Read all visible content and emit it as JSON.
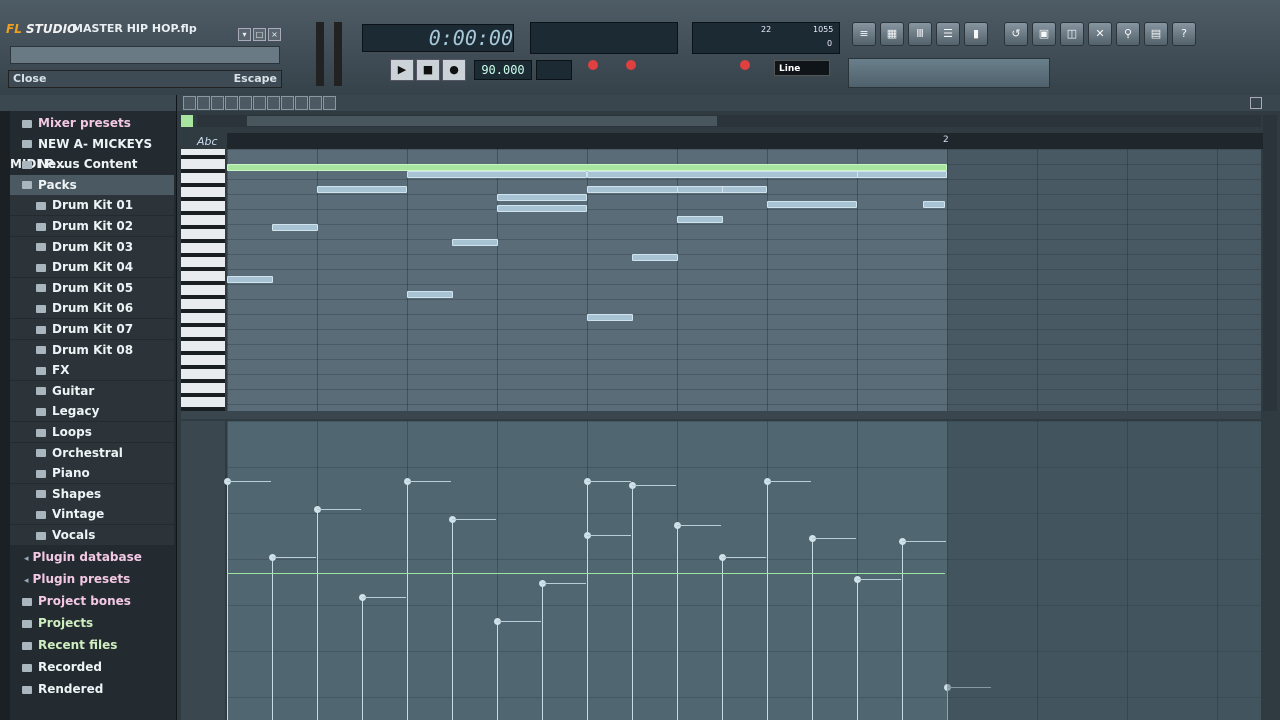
{
  "app": {
    "logo_prefix": "FL",
    "logo_suffix": "STUDIO",
    "song_title": "MASTER HIP HOP.flp",
    "close_label": "Close",
    "close_shortcut": "Escape",
    "time_display": "0:00:00",
    "tempo": "90.000",
    "mode": "Line",
    "cpu_value": "22",
    "ram_value": "1055",
    "poly_value": "0"
  },
  "transport": {
    "play_icon": "play-icon",
    "stop_icon": "stop-icon",
    "record_icon": "record-icon"
  },
  "browser": {
    "items": [
      {
        "label": "Mixer presets",
        "kind": "folder",
        "color": "pink"
      },
      {
        "label": "NEW A- MICKEYS MIDI P...",
        "kind": "folder"
      },
      {
        "label": "Nexus Content",
        "kind": "folder"
      },
      {
        "label": "Packs",
        "kind": "folder",
        "selected": true
      },
      {
        "label": "Drum Kit 01",
        "kind": "sub"
      },
      {
        "label": "Drum Kit 02",
        "kind": "sub"
      },
      {
        "label": "Drum Kit 03",
        "kind": "sub"
      },
      {
        "label": "Drum Kit 04",
        "kind": "sub"
      },
      {
        "label": "Drum Kit 05",
        "kind": "sub"
      },
      {
        "label": "Drum Kit 06",
        "kind": "sub"
      },
      {
        "label": "Drum Kit 07",
        "kind": "sub"
      },
      {
        "label": "Drum Kit 08",
        "kind": "sub"
      },
      {
        "label": "FX",
        "kind": "sub"
      },
      {
        "label": "Guitar",
        "kind": "sub"
      },
      {
        "label": "Legacy",
        "kind": "sub"
      },
      {
        "label": "Loops",
        "kind": "sub"
      },
      {
        "label": "Orchestral",
        "kind": "sub"
      },
      {
        "label": "Piano",
        "kind": "sub"
      },
      {
        "label": "Shapes",
        "kind": "sub"
      },
      {
        "label": "Vintage",
        "kind": "sub"
      },
      {
        "label": "Vocals",
        "kind": "sub"
      },
      {
        "label": "Plugin database",
        "kind": "plugin",
        "color": "pink"
      },
      {
        "label": "Plugin presets",
        "kind": "plugin",
        "color": "pink"
      },
      {
        "label": "Project bones",
        "kind": "folder",
        "color": "pink"
      },
      {
        "label": "Projects",
        "kind": "folder",
        "color": "green"
      },
      {
        "label": "Recent files",
        "kind": "folder",
        "color": "green"
      },
      {
        "label": "Recorded",
        "kind": "folder"
      },
      {
        "label": "Rendered",
        "kind": "folder"
      }
    ]
  },
  "piano_roll": {
    "ruler_bar_marker": "2",
    "label_tool": "Abc"
  },
  "colors": {
    "note": "#a8c4d4",
    "long_note": "#a8e6a0",
    "grid": "#5a6c77",
    "velocity_bg": "#506671",
    "accent_orange": "#f0a020"
  }
}
